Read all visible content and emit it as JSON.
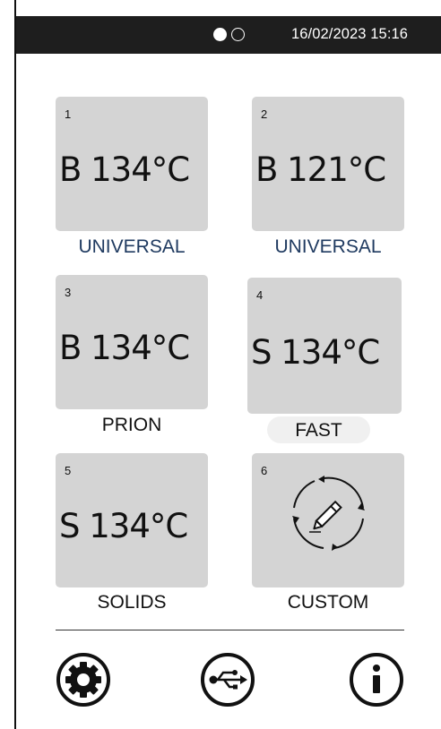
{
  "status_bar": {
    "indicator_dots": [
      "filled",
      "empty"
    ],
    "datetime": "16/02/2023 15:16"
  },
  "programs": [
    {
      "number": "1",
      "name": "B 134°C",
      "label": "UNIVERSAL"
    },
    {
      "number": "2",
      "name": "B 121°C",
      "label": "UNIVERSAL"
    },
    {
      "number": "3",
      "name": "B 134°C",
      "label": "PRION"
    },
    {
      "number": "4",
      "name": "S 134°C",
      "label": "FAST"
    },
    {
      "number": "5",
      "name": "S 134°C",
      "label": "SOLIDS"
    },
    {
      "number": "6",
      "icon": "edit-cycle-icon",
      "label": "CUSTOM"
    }
  ],
  "bottom_bar": {
    "icons": [
      "settings-gear-icon",
      "usb-icon",
      "info-icon"
    ]
  },
  "colors": {
    "status_bar_bg": "#1e1e1e",
    "tile_bg": "#d4d4d4",
    "label_blue": "#1f3a60"
  }
}
